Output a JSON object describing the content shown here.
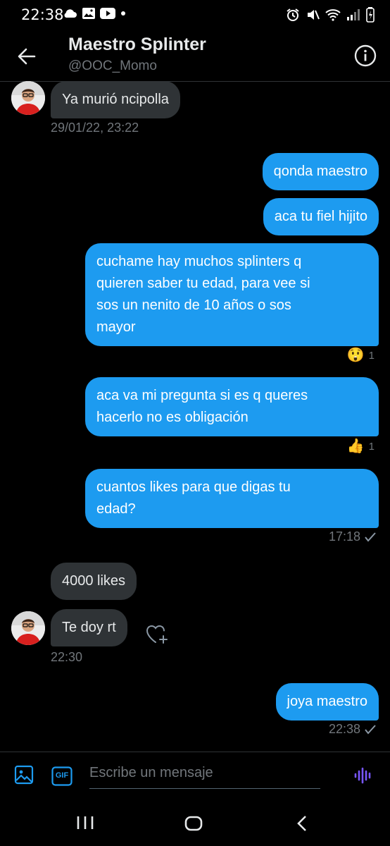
{
  "status_bar": {
    "time": "22:38",
    "left_icons": [
      "cloud-icon",
      "gallery-icon",
      "youtube-icon",
      "dot-icon"
    ],
    "right_icons": [
      "alarm-icon",
      "mute-icon",
      "wifi-icon",
      "signal-icon",
      "battery-icon"
    ]
  },
  "header": {
    "title": "Maestro Splinter",
    "handle": "@OOC_Momo"
  },
  "messages": {
    "m1": {
      "text": "Ya murió ncipolla",
      "direction": "in"
    },
    "m1_time": "29/01/22, 23:22",
    "m2": {
      "text": "qonda maestro",
      "direction": "out"
    },
    "m3": {
      "text": "aca tu fiel hijito",
      "direction": "out"
    },
    "m4": {
      "line1": "cuchame hay muchos splinters q",
      "line2": "quieren saber tu edad, para vee si",
      "line3": "sos un nenito de 10 años o sos",
      "line4": "mayor",
      "direction": "out"
    },
    "m4_reaction": {
      "emoji": "😲",
      "count": "1"
    },
    "m5": {
      "line1": "aca va mi pregunta si es q queres",
      "line2": "hacerlo no es obligación",
      "direction": "out"
    },
    "m5_reaction": {
      "emoji": "👍",
      "count": "1"
    },
    "m6": {
      "line1": "cuantos likes para que digas tu",
      "line2": "edad?",
      "direction": "out"
    },
    "m6_time": "17:18",
    "m7": {
      "text": "4000 likes",
      "direction": "in"
    },
    "m8": {
      "text": "Te doy rt",
      "direction": "in"
    },
    "m8_time": "22:30",
    "m9": {
      "text": "joya maestro",
      "direction": "out"
    },
    "m9_time": "22:38"
  },
  "composer": {
    "placeholder": "Escribe un mensaje",
    "gif_label": "GIF"
  },
  "colors": {
    "accent": "#1d9bf0",
    "incoming_bubble": "#2f3336",
    "background": "#000000",
    "muted_text": "#71767b"
  }
}
